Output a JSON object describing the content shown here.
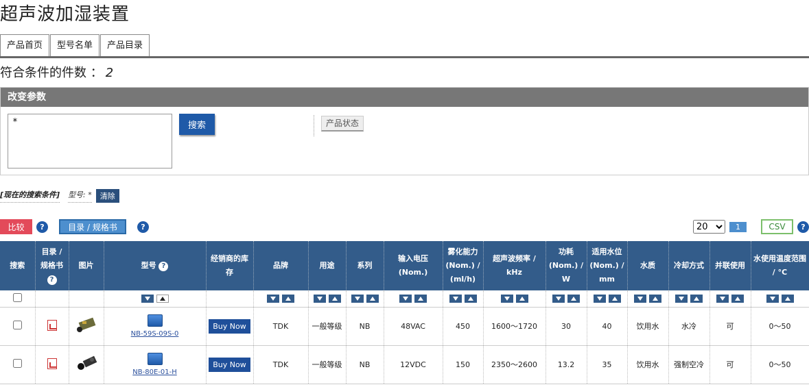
{
  "page": {
    "title": "超声波加湿装置"
  },
  "tabs": [
    "产品首页",
    "型号名单",
    "产品目录"
  ],
  "result": {
    "label": "符合条件的件数 ：",
    "count": "2"
  },
  "params": {
    "header": "改变参数",
    "model_input": "*",
    "search_label": "搜索",
    "state_label": "产品状态"
  },
  "conditions": {
    "label": "[现在的搜索条件]",
    "value": "型号: *",
    "clear_label": "清除"
  },
  "toolbar": {
    "compare_label": "比较",
    "catalog_label": "目录 / 规格书",
    "per_page": "20",
    "page_number": "1",
    "csv_label": "CSV"
  },
  "columns": [
    "搜索",
    "目录 / 规格书",
    "图片",
    "型号",
    "经销商的库存",
    "品牌",
    "用途",
    "系列",
    "输入电压 (Nom.)",
    "雾化能力 (Nom.) / (ml/h)",
    "超声波频率 / kHz",
    "功耗 (Nom.) / W",
    "适用水位 (Nom.) / mm",
    "水质",
    "冷却方式",
    "并联使用",
    "水使用温度范围 / °C"
  ],
  "rows": [
    {
      "model": "NB-59S-09S-0",
      "buy": "Buy Now",
      "brand": "TDK",
      "usage": "一般等级",
      "series": "NB",
      "voltage": "48VAC",
      "capacity": "450",
      "freq": "1600～1720",
      "power": "30",
      "level": "40",
      "water": "饮用水",
      "cooling": "水冷",
      "parallel": "可",
      "temp": "0～50"
    },
    {
      "model": "NB-80E-01-H",
      "buy": "Buy Now",
      "brand": "TDK",
      "usage": "一般等级",
      "series": "NB",
      "voltage": "12VDC",
      "capacity": "150",
      "freq": "2350～2600",
      "power": "13.2",
      "level": "35",
      "water": "饮用水",
      "cooling": "强制空冷",
      "parallel": "可",
      "temp": "0～50"
    }
  ],
  "icons": {
    "help": "?"
  }
}
